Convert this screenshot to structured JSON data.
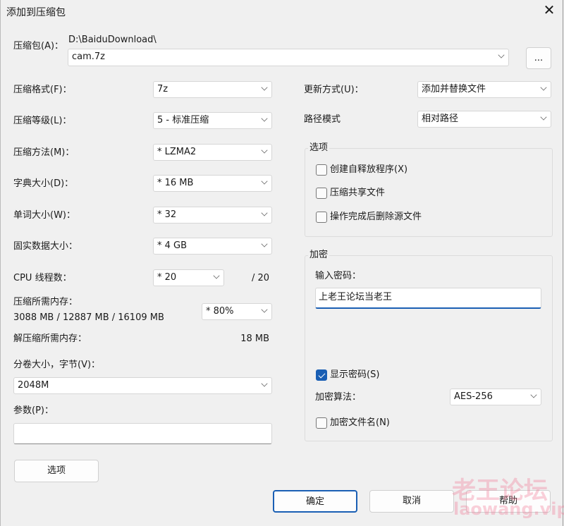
{
  "title": "添加到压缩包",
  "archive": {
    "label": "压缩包(A)：",
    "path": "D:\\BaiduDownload\\",
    "value": "cam.7z",
    "browse": "..."
  },
  "left": {
    "format": {
      "label": "压缩格式(F)：",
      "value": "7z"
    },
    "level": {
      "label": "压缩等级(L)：",
      "value": "5 - 标准压缩"
    },
    "method": {
      "label": "压缩方法(M)：",
      "value": "*  LZMA2"
    },
    "dict": {
      "label": "字典大小(D)：",
      "value": "*  16 MB"
    },
    "word": {
      "label": "单词大小(W)：",
      "value": "*  32"
    },
    "solid": {
      "label": "固实数据大小：",
      "value": "*  4 GB"
    },
    "cpu": {
      "label": "CPU 线程数：",
      "value": "*  20",
      "max": "/ 20"
    },
    "mem": {
      "label": "压缩所需内存：",
      "values": "3088 MB / 12887 MB / 16109 MB",
      "value": "* 80%"
    },
    "dmem": {
      "label": "解压缩所需内存：",
      "value": "18 MB"
    },
    "split": {
      "label": "分卷大小，字节(V)：",
      "value": "2048M"
    },
    "params": {
      "label": "参数(P)：",
      "value": ""
    },
    "options_button": "选项"
  },
  "right": {
    "update": {
      "label": "更新方式(U)：",
      "value": "添加并替换文件"
    },
    "pathmode": {
      "label": "路径模式",
      "value": "相对路径"
    },
    "options": {
      "title": "选项",
      "items": [
        {
          "label": "创建自释放程序(X)",
          "checked": false
        },
        {
          "label": "压缩共享文件",
          "checked": false
        },
        {
          "label": "操作完成后删除源文件",
          "checked": false
        }
      ]
    },
    "encryption": {
      "title": "加密",
      "password_label": "输入密码：",
      "password": "上老王论坛当老王",
      "show_password": {
        "label": "显示密码(S)",
        "checked": true
      },
      "method_label": "加密算法：",
      "method": "AES-256",
      "encrypt_names": {
        "label": "加密文件名(N)",
        "checked": false
      }
    }
  },
  "buttons": {
    "ok": "确定",
    "cancel": "取消",
    "help": "帮助"
  },
  "watermark": {
    "line1": "老王论坛",
    "line2": "laowang.vip"
  }
}
